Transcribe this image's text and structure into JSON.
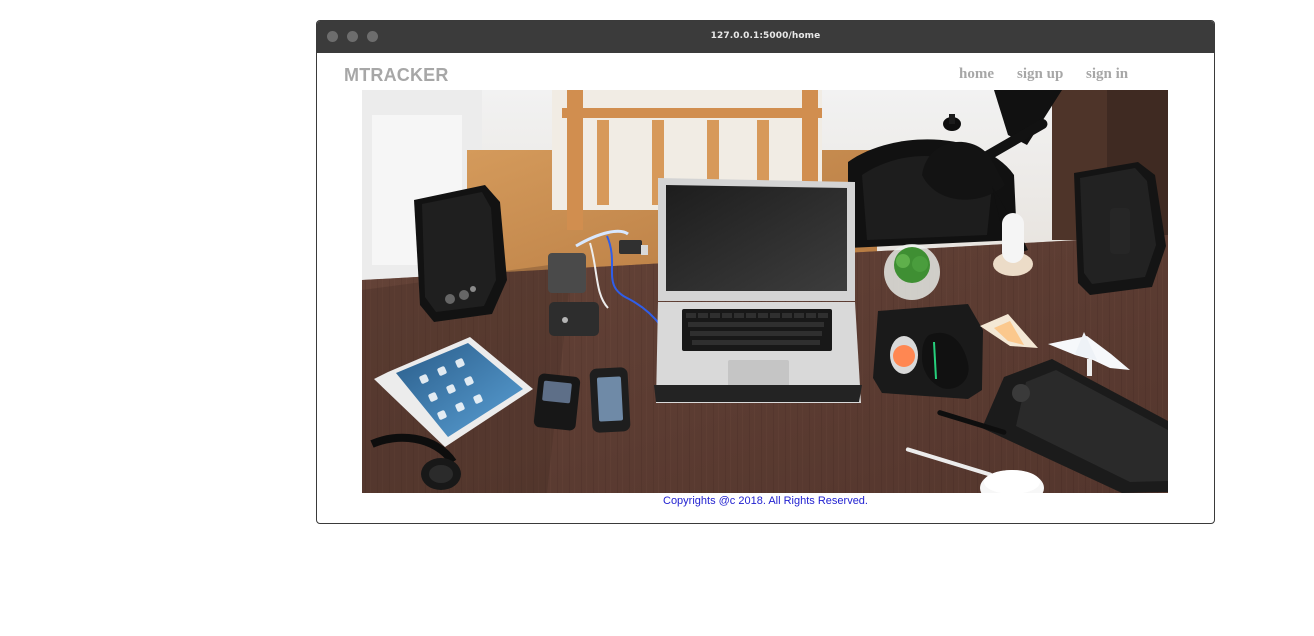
{
  "browser": {
    "url": "127.0.0.1:5000/home",
    "traffic_lights": [
      "close-dot",
      "minimize-dot",
      "maximize-dot"
    ]
  },
  "navbar": {
    "brand": "MTRACKER",
    "links": [
      {
        "label": "home"
      },
      {
        "label": "sign up"
      },
      {
        "label": "sign in"
      }
    ]
  },
  "hero": {
    "kind": "desk-workspace-photo"
  },
  "footer": {
    "text": "Copyrights @c 2018. All Rights Reserved."
  },
  "colors": {
    "titlebar": "#3b3b3b",
    "nav_text": "#a7a7a7",
    "footer_link": "#1f1fd0",
    "desk": "#5a3a2f"
  }
}
